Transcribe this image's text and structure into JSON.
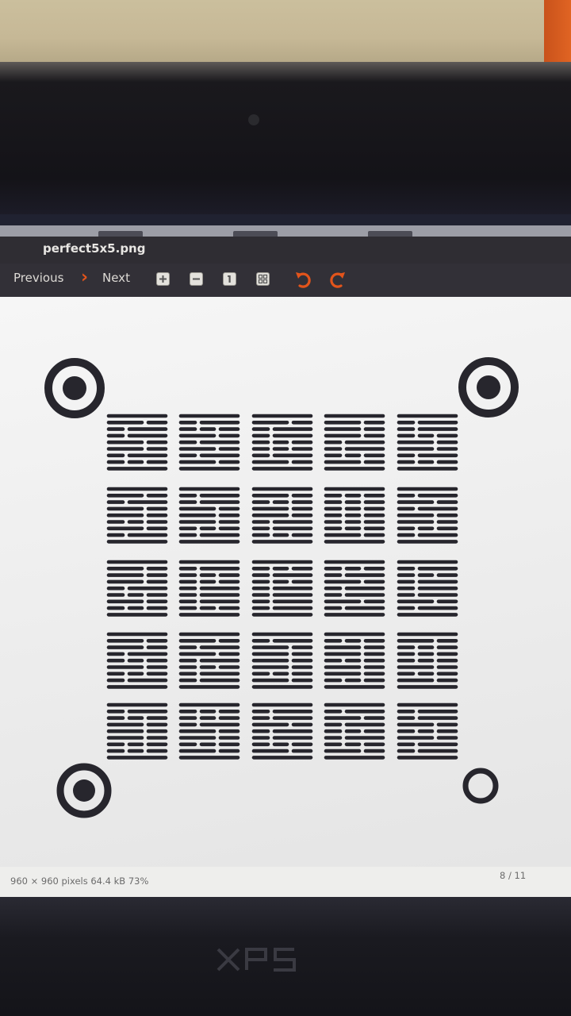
{
  "window": {
    "title": "perfect5x5.png"
  },
  "toolbar": {
    "previous_label": "Previous",
    "next_label": "Next",
    "icons": [
      "zoom-in-icon",
      "zoom-out-icon",
      "zoom-normal-icon",
      "best-fit-icon",
      "rotate-left-icon",
      "rotate-right-icon"
    ],
    "accent_color": "#e2541b"
  },
  "statusbar": {
    "info": "960 × 960 pixels  64.4 kB   73%",
    "page_position": "8 / 11"
  },
  "laptop": {
    "logo_text": "XPS"
  }
}
